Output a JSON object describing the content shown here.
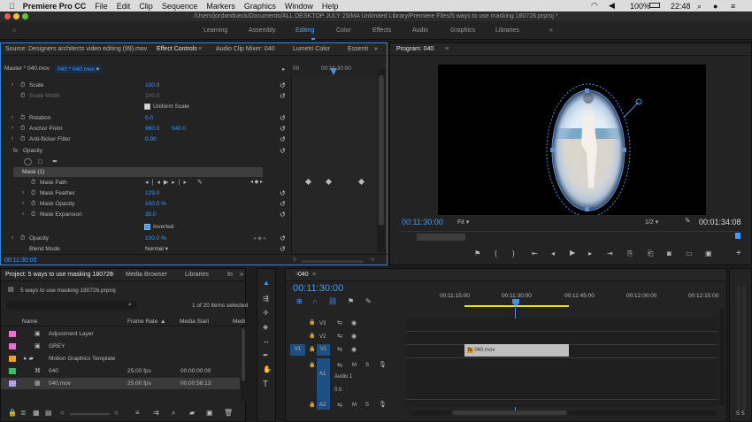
{
  "menubar": {
    "app": "Premiere Pro CC",
    "items": [
      "File",
      "Edit",
      "Clip",
      "Sequence",
      "Markers",
      "Graphics",
      "Window",
      "Help"
    ],
    "battery": "100%",
    "time": "22:48"
  },
  "title": "/Users/jordandueck/Documents/ALL DESKTOP JULY 25/MA Unlimited Library/Premiere Files/5 ways to use masking 180726.prproj *",
  "workspaces": {
    "items": [
      "Learning",
      "Assembly",
      "Editing",
      "Color",
      "Effects",
      "Audio",
      "Graphics",
      "Libraries"
    ],
    "active": "Editing",
    "more": "»"
  },
  "effect_controls": {
    "tabs": [
      "Source: Designers architects video editing (99).mov",
      "Effect Controls",
      "Audio Clip Mixer: 040",
      "Lumetri Color",
      "Essenti"
    ],
    "master": "Master * 040.mov",
    "clip": "040 * 040.mov",
    "ruler_time": "00:11:30:00",
    "ruler_left": "00",
    "scale": {
      "label": "Scale",
      "value": "100.0"
    },
    "scale_width": {
      "label": "Scale Width",
      "value": "100.0"
    },
    "uniform": {
      "label": "Uniform Scale"
    },
    "rotation": {
      "label": "Rotation",
      "value": "0.0"
    },
    "anchor": {
      "label": "Anchor Point",
      "x": "960.0",
      "y": "540.0"
    },
    "flicker": {
      "label": "Anti-flicker Filter",
      "value": "0.00"
    },
    "opacity_section": {
      "fx": "fx",
      "label": "Opacity"
    },
    "mask": {
      "label": "Mask (1)"
    },
    "mask_path": {
      "label": "Mask Path"
    },
    "mask_feather": {
      "label": "Mask Feather",
      "value": "129.0"
    },
    "mask_opacity": {
      "label": "Mask Opacity",
      "value": "100.0 %"
    },
    "mask_expansion": {
      "label": "Mask Expansion",
      "value": "30.0"
    },
    "inverted": {
      "label": "Inverted"
    },
    "opacity": {
      "label": "Opacity",
      "value": "100.0 %"
    },
    "blend": {
      "label": "Blend Mode",
      "value": "Normal"
    },
    "footer_time": "00:11:30:00"
  },
  "program": {
    "tab": "Program: 040",
    "timecode": "00:11:30:00",
    "fit": "Fit",
    "resolution": "1/2",
    "duration": "00:01:34:08"
  },
  "project": {
    "tabs": [
      "Project: 5 ways to use masking 180726",
      "Media Browser",
      "Libraries",
      "In"
    ],
    "file": "5 ways to use masking 180726.prproj",
    "selection": "1 of 20 items selected",
    "columns": [
      "Name",
      "Frame Rate",
      "Media Start",
      "Medi"
    ],
    "rows": [
      {
        "name": "Adjustment Layer",
        "fps": "",
        "start": "",
        "color": "#e86fd6"
      },
      {
        "name": "GREY",
        "fps": "",
        "start": "",
        "color": "#e86fd6"
      },
      {
        "name": "Motion Graphics Template",
        "fps": "",
        "start": "",
        "color": "#f0a030"
      },
      {
        "name": "040",
        "fps": "25.00 fps",
        "start": "00:00:00:00",
        "color": "#3fba6b"
      },
      {
        "name": "040.mov",
        "fps": "25.00 fps",
        "start": "00:00:58:13",
        "color": "#b79cf0"
      }
    ]
  },
  "timeline": {
    "tab": "040",
    "timecode": "00:11:30:00",
    "ruler": [
      "00:11:15:00",
      "00:11:30:00",
      "00:11:45:00",
      "00:12:00:00",
      "00:12:15:00"
    ],
    "tracks_video": [
      "V3",
      "V2",
      "V1"
    ],
    "tracks_audio": [
      "A1",
      "A2"
    ],
    "src_v": "V1",
    "audio_label": "Audio 1",
    "clip": "040.mov",
    "db": "0.0",
    "meter": "S S"
  },
  "colors": {
    "accent": "#3d9bff",
    "playhead": "#4a90e2",
    "clip": "#bfbfbf"
  }
}
